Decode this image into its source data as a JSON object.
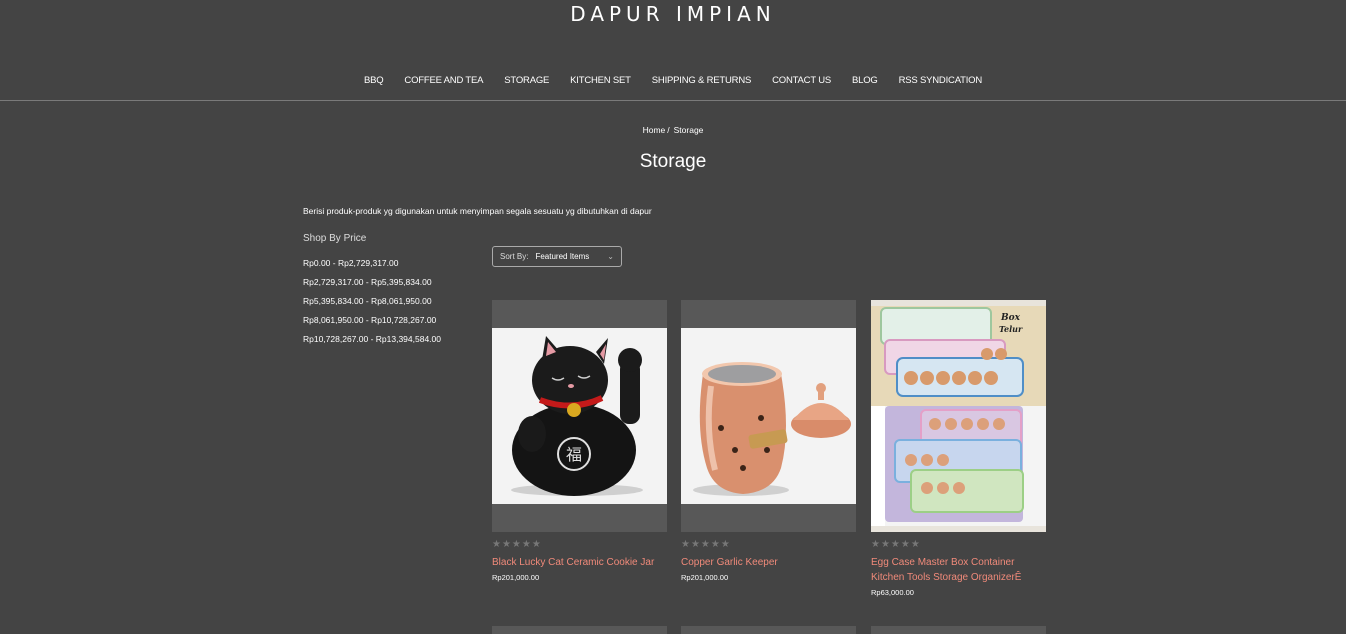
{
  "header": {
    "logo": "DAPUR IMPIAN"
  },
  "nav": {
    "items": [
      {
        "label": "BBQ"
      },
      {
        "label": "COFFEE AND TEA"
      },
      {
        "label": "STORAGE"
      },
      {
        "label": "KITCHEN SET"
      },
      {
        "label": "SHIPPING & RETURNS"
      },
      {
        "label": "CONTACT US"
      },
      {
        "label": "BLOG"
      },
      {
        "label": "RSS SYNDICATION"
      }
    ]
  },
  "breadcrumb": {
    "home": "Home",
    "separator": "/",
    "current": "Storage"
  },
  "page": {
    "title": "Storage",
    "description": "Berisi produk-produk yg digunakan untuk menyimpan segala sesuatu yg dibutuhkan di dapur"
  },
  "sidebar": {
    "heading": "Shop By Price",
    "price_ranges": [
      "Rp0.00 - Rp2,729,317.00",
      "Rp2,729,317.00 - Rp5,395,834.00",
      "Rp5,395,834.00 - Rp8,061,950.00",
      "Rp8,061,950.00 - Rp10,728,267.00",
      "Rp10,728,267.00 - Rp13,394,584.00"
    ]
  },
  "sort": {
    "label": "Sort By:",
    "selected": "Featured Items"
  },
  "products": [
    {
      "name": "Black Lucky Cat Ceramic Cookie Jar",
      "price": "Rp201,000.00",
      "rating": 0
    },
    {
      "name": "Copper Garlic Keeper",
      "price": "Rp201,000.00",
      "rating": 0
    },
    {
      "name": "Egg Case Master Box Container Kitchen Tools Storage OrganizerÊ",
      "price": "Rp63,000.00",
      "rating": 0,
      "image_caption": "Box Telur"
    }
  ],
  "colors": {
    "background": "#444444",
    "product_name": "#f08a7a",
    "image_placeholder": "#585858"
  },
  "icons": {
    "sort_dropdown": "chevron-down-icon",
    "rating": "star-icon"
  }
}
